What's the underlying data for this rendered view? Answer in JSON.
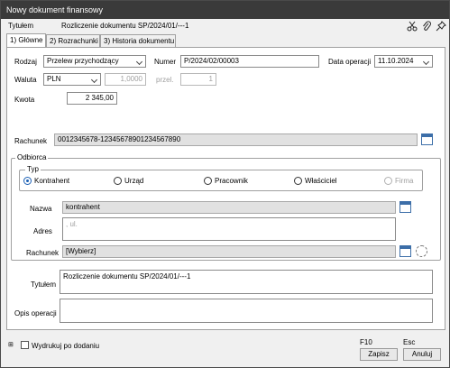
{
  "window": {
    "title": "Nowy dokument finansowy"
  },
  "header": {
    "tytulem_label": "Tytułem",
    "tytulem_value": "Rozliczenie dokumentu SP/2024/01/---1"
  },
  "tabs": [
    {
      "label": "1) Główne"
    },
    {
      "label": "2) Rozrachunki"
    },
    {
      "label": "3) Historia dokumentu"
    }
  ],
  "form": {
    "rodzaj_label": "Rodzaj",
    "rodzaj_value": "Przelew przychodzący",
    "numer_label": "Numer",
    "numer_value": "P/2024/02/00003",
    "data_label": "Data operacji",
    "data_value": "11.10.2024",
    "waluta_label": "Waluta",
    "waluta_value": "PLN",
    "kurs_value": "1,0000",
    "przel_label": "przel.",
    "przel_value": "1",
    "kwota_label": "Kwota",
    "kwota_value": "2 345,00",
    "rachunek_label": "Rachunek",
    "rachunek_value": "0012345678-12345678901234567890"
  },
  "odbiorca": {
    "label": "Odbiorca",
    "typ_label": "Typ",
    "types": [
      {
        "label": "Kontrahent",
        "selected": true
      },
      {
        "label": "Urząd"
      },
      {
        "label": "Pracownik"
      },
      {
        "label": "Właściciel"
      },
      {
        "label": "Firma",
        "disabled": true
      }
    ],
    "nazwa_label": "Nazwa",
    "nazwa_value": "kontrahent",
    "adres_label": "Adres",
    "adres_value": ", ul.",
    "rachunek_label": "Rachunek",
    "rachunek_value": "[Wybierz]"
  },
  "tytulem": {
    "label": "Tytułem",
    "value": "Rozliczenie dokumentu SP/2024/01/---1"
  },
  "opis": {
    "label": "Opis operacji",
    "value": ""
  },
  "footer": {
    "print_label": "Wydrukuj po dodaniu",
    "save_shortcut": "F10",
    "save_label": "Zapisz",
    "cancel_shortcut": "Esc",
    "cancel_label": "Anuluj"
  }
}
